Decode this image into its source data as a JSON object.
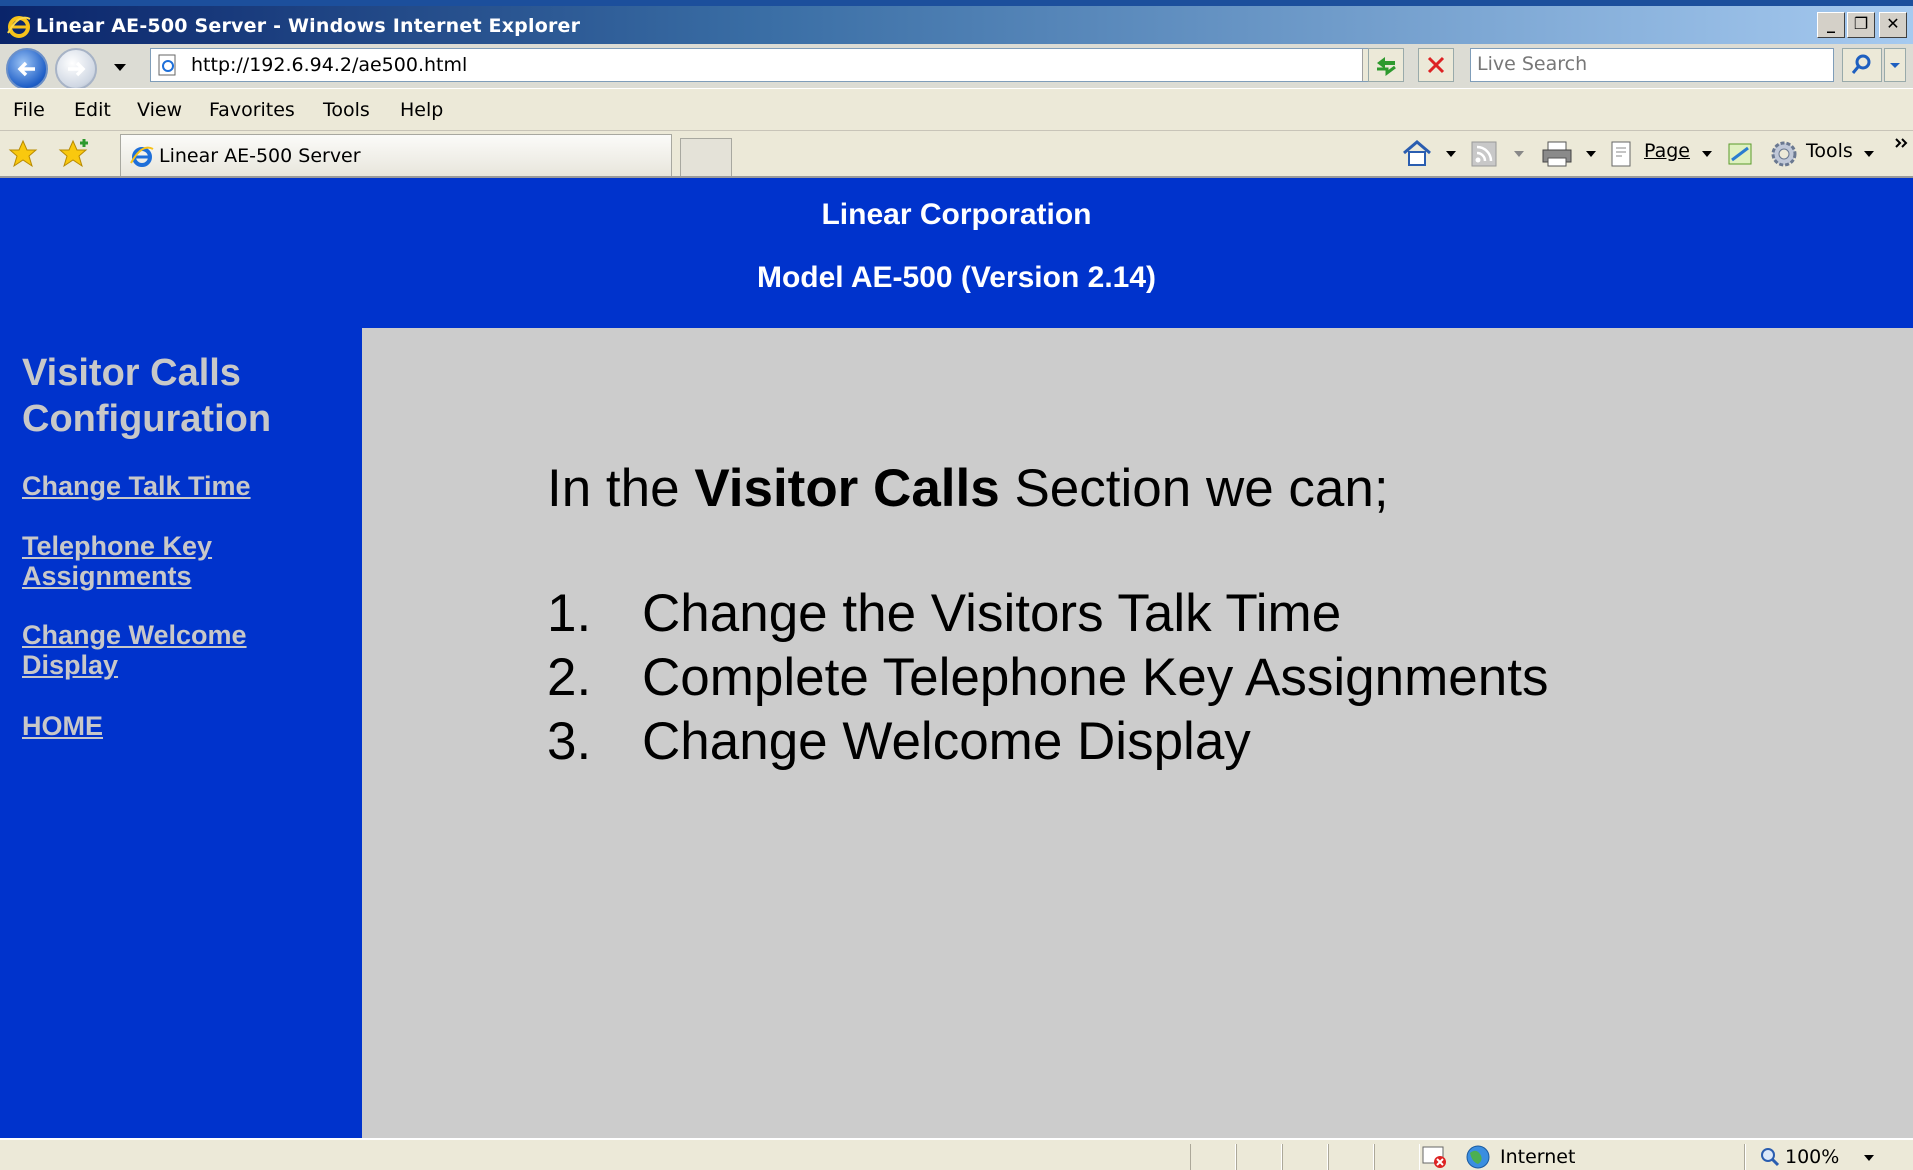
{
  "window": {
    "title": "Linear AE-500 Server - Windows Internet Explorer",
    "controls": [
      "_",
      "❐",
      "✕"
    ]
  },
  "address": {
    "url": "http://192.6.94.2/ae500.html",
    "search_placeholder": "Live Search"
  },
  "menu": [
    "File",
    "Edit",
    "View",
    "Favorites",
    "Tools",
    "Help"
  ],
  "tab": {
    "label": "Linear AE-500 Server"
  },
  "command_bar": {
    "page_label": "Page",
    "tools_label": "Tools"
  },
  "page": {
    "company": "Linear Corporation",
    "model": "Model AE-500 (Version 2.14)",
    "sidebar": {
      "section_title": "Visitor Calls Configuration",
      "links": [
        "Change Talk Time",
        "Telephone Key Assignments",
        "Change Welcome Display",
        "HOME"
      ]
    },
    "main": {
      "intro_before": "In the ",
      "intro_bold": "Visitor Calls",
      "intro_after": " Section we can;",
      "items": [
        {
          "num": "1.",
          "text": "Change the Visitors Talk Time"
        },
        {
          "num": "2.",
          "text": "Complete Telephone Key Assignments"
        },
        {
          "num": "3.",
          "text": "Change Welcome Display"
        }
      ]
    }
  },
  "status": {
    "zone": "Internet",
    "zoom": "100%"
  },
  "colors": {
    "page_blue": "#0033cc",
    "content_gray": "#cccccc",
    "sidebar_text": "#c8c8c8"
  }
}
